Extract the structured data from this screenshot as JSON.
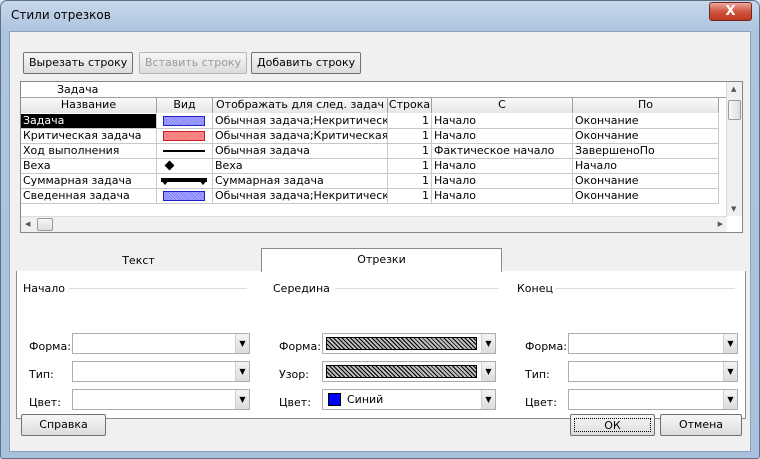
{
  "window": {
    "title": "Стили отрезков",
    "close_label": "X"
  },
  "toolbar": {
    "cut_row": "Вырезать строку",
    "paste_row": "Вставить строку",
    "add_row": "Добавить строку"
  },
  "grid": {
    "edit_value": "Задача",
    "columns": [
      "Название",
      "Вид",
      "Отображать для след. задач",
      "Строка",
      "С",
      "По"
    ],
    "rows": [
      {
        "name": "Задача",
        "bar": "blue-bar",
        "show_for": "Обычная задача;Некритическа",
        "row": "1",
        "from": "Начало",
        "to": "Окончание",
        "selected": true
      },
      {
        "name": "Критическая задача",
        "bar": "red-bar",
        "show_for": "Обычная задача;Критическая з",
        "row": "1",
        "from": "Начало",
        "to": "Окончание"
      },
      {
        "name": "Ход выполнения",
        "bar": "progress-line",
        "show_for": "Обычная задача",
        "row": "1",
        "from": "Фактическое начало",
        "to": "ЗавершеноПо"
      },
      {
        "name": "Веха",
        "bar": "diamond",
        "show_for": "Веха",
        "row": "1",
        "from": "Начало",
        "to": "Начало"
      },
      {
        "name": "Суммарная задача",
        "bar": "summary-bracket",
        "show_for": "Суммарная задача",
        "row": "1",
        "from": "Начало",
        "to": "Окончание"
      },
      {
        "name": "Сведенная задача",
        "bar": "blue-bar",
        "show_for": "Обычная задача;Некритическа",
        "row": "1",
        "from": "Начало",
        "to": "Окончание"
      }
    ]
  },
  "tabs": {
    "text": "Текст",
    "bars": "Отрезки"
  },
  "sections": {
    "start": {
      "title": "Начало",
      "shape": "Форма:",
      "type": "Тип:",
      "color": "Цвет:"
    },
    "middle": {
      "title": "Середина",
      "shape": "Форма:",
      "pattern": "Узор:",
      "color": "Цвет:",
      "color_value": "Синий"
    },
    "end": {
      "title": "Конец",
      "shape": "Форма:",
      "type": "Тип:",
      "color": "Цвет:"
    }
  },
  "footer": {
    "help": "Справка",
    "ok": "ОК",
    "cancel": "Отмена"
  },
  "colors": {
    "selected_row": "#000000",
    "middle_color": "#0000ff"
  }
}
